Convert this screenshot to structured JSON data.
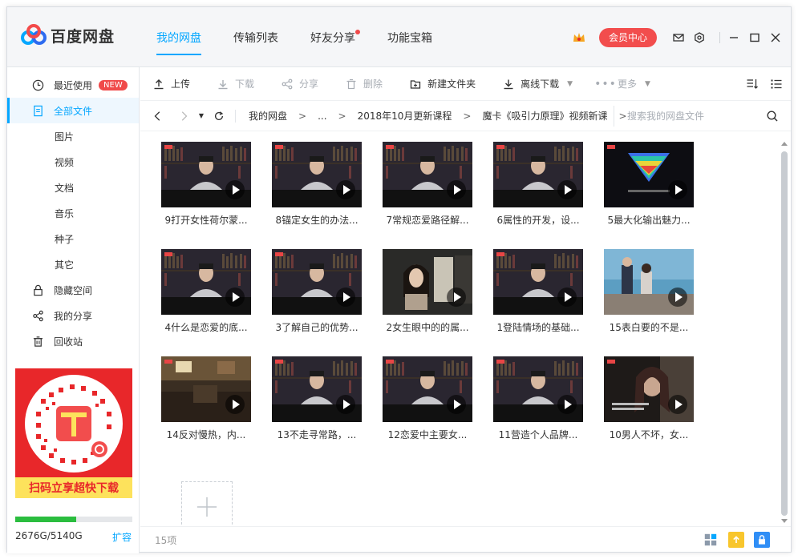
{
  "app": {
    "name": "百度网盘"
  },
  "nav": {
    "tabs": [
      "我的网盘",
      "传输列表",
      "好友分享",
      "功能宝箱"
    ]
  },
  "header": {
    "vip_label": "会员中心"
  },
  "sidebar": {
    "items": [
      {
        "label": "最近使用",
        "badge": "NEW"
      },
      {
        "label": "全部文件"
      },
      {
        "label": "图片"
      },
      {
        "label": "视频"
      },
      {
        "label": "文档"
      },
      {
        "label": "音乐"
      },
      {
        "label": "种子"
      },
      {
        "label": "其它"
      },
      {
        "label": "隐藏空间"
      },
      {
        "label": "我的分享"
      },
      {
        "label": "回收站"
      }
    ],
    "promo_text": "扫码立享超快下载",
    "quota": {
      "used_fraction": 0.52,
      "text": "2676G/5140G",
      "expand_label": "扩容"
    }
  },
  "toolbar": {
    "upload": "上传",
    "download": "下载",
    "share": "分享",
    "delete": "删除",
    "new_folder": "新建文件夹",
    "offline_download": "离线下载",
    "more": "更多"
  },
  "address": {
    "crumbs": [
      "我的网盘",
      "...",
      "2018年10月更新课程",
      "魔卡《吸引力原理》视频新课"
    ],
    "crumb_sep": ">",
    "search_placeholder": "搜索我的网盘文件"
  },
  "files": [
    {
      "name": "9打开女性荷尔蒙...",
      "scene": "lecture"
    },
    {
      "name": "8锚定女生的办法...",
      "scene": "lecture"
    },
    {
      "name": "7常规恋爱路径解...",
      "scene": "lecture"
    },
    {
      "name": "6属性的开发，设...",
      "scene": "lecture"
    },
    {
      "name": "5最大化输出魅力...",
      "scene": "funnel"
    },
    {
      "name": "4什么是恋爱的底...",
      "scene": "lecture"
    },
    {
      "name": "3了解自己的优势...",
      "scene": "lecture"
    },
    {
      "name": "2女生眼中的的属...",
      "scene": "movie"
    },
    {
      "name": "1登陆情场的基础...",
      "scene": "lecture"
    },
    {
      "name": "15表白要的不是...",
      "scene": "beach"
    },
    {
      "name": "14反对慢热，内...",
      "scene": "interior"
    },
    {
      "name": "13不走寻常路，...",
      "scene": "lecture"
    },
    {
      "name": "12恋爱中主要女...",
      "scene": "lecture"
    },
    {
      "name": "11营造个人品牌...",
      "scene": "lecture"
    },
    {
      "name": "10男人不坏，女...",
      "scene": "woman"
    }
  ],
  "status": {
    "count": "15项"
  },
  "colors": {
    "accent": "#06a7ff",
    "vip": "#f24d4d",
    "quota": "#2bbd3f"
  }
}
